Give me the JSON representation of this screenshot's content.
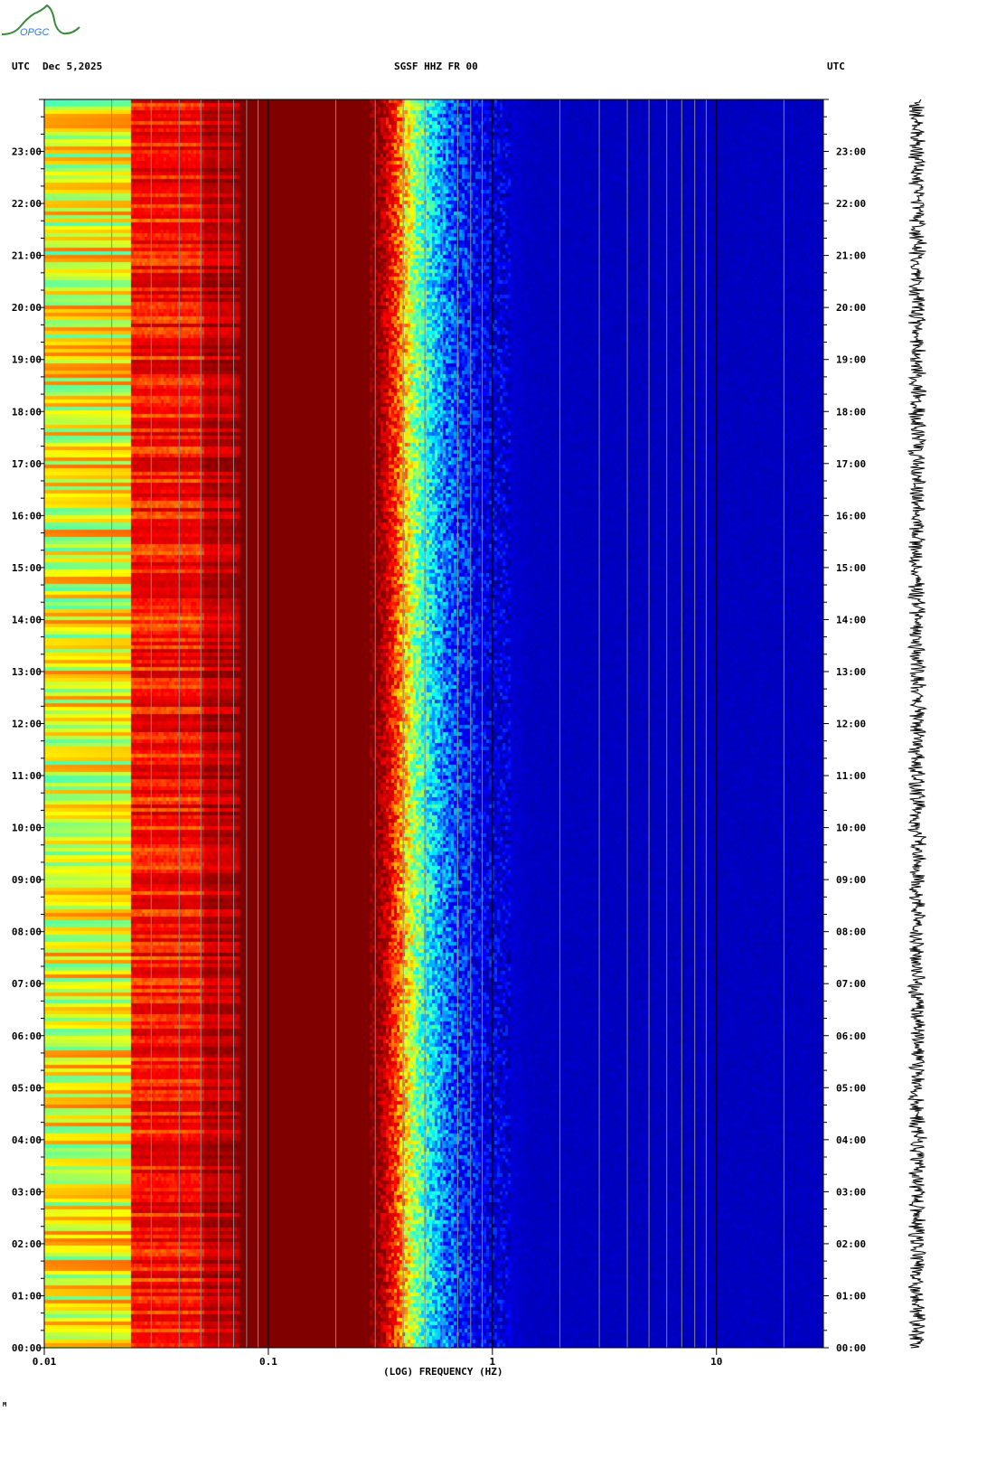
{
  "header": {
    "logo_text": "OPGC",
    "left_tz": "UTC",
    "date": "Dec 5,2025",
    "station": "SGSF HHZ FR 00",
    "right_tz": "UTC"
  },
  "footer_mark": "M",
  "chart_data": {
    "type": "heatmap",
    "title": "SGSF HHZ FR 00",
    "xlabel": "(LOG) FREQUENCY (HZ)",
    "xscale": "log",
    "xlim": [
      0.01,
      30
    ],
    "xticks": [
      {
        "value": 0.01,
        "label": "0.01"
      },
      {
        "value": 0.1,
        "label": "0.1"
      },
      {
        "value": 1,
        "label": "1"
      },
      {
        "value": 10,
        "label": "10"
      }
    ],
    "ylabel": "UTC",
    "ylim_hours": [
      0,
      24
    ],
    "yticks": [
      "00:00",
      "01:00",
      "02:00",
      "03:00",
      "04:00",
      "05:00",
      "06:00",
      "07:00",
      "08:00",
      "09:00",
      "10:00",
      "11:00",
      "12:00",
      "13:00",
      "14:00",
      "15:00",
      "16:00",
      "17:00",
      "18:00",
      "19:00",
      "20:00",
      "21:00",
      "22:00",
      "23:00"
    ],
    "colormap": [
      "#000080",
      "#0000ff",
      "#00ffff",
      "#ffff00",
      "#ff0000",
      "#800000"
    ],
    "spectral_profile": [
      {
        "freq": 0.01,
        "level": 0.58
      },
      {
        "freq": 0.0239,
        "level": 0.6
      },
      {
        "freq": 0.024,
        "level": 0.8
      },
      {
        "freq": 0.05,
        "level": 0.8
      },
      {
        "freq": 0.051,
        "level": 0.9
      },
      {
        "freq": 0.072,
        "level": 0.9
      },
      {
        "freq": 0.073,
        "level": 1.0
      },
      {
        "freq": 0.3,
        "level": 1.0
      },
      {
        "freq": 0.36,
        "level": 0.78
      },
      {
        "freq": 0.45,
        "level": 0.5
      },
      {
        "freq": 0.6,
        "level": 0.3
      },
      {
        "freq": 0.85,
        "level": 0.17
      },
      {
        "freq": 1.5,
        "level": 0.1
      },
      {
        "freq": 30,
        "level": 0.1
      }
    ],
    "trace": "seismogram, 24 h, right panel"
  }
}
